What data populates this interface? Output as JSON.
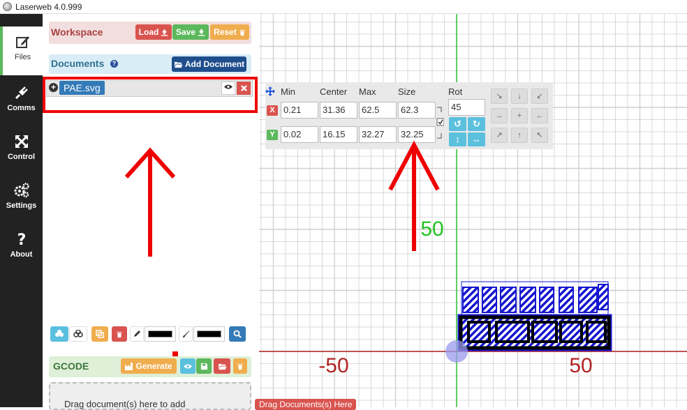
{
  "window": {
    "title": "Laserweb 4.0.999"
  },
  "sidebar": {
    "items": [
      {
        "label": "Files",
        "icon": "edit-icon",
        "active": true
      },
      {
        "label": "Comms",
        "icon": "plug-icon"
      },
      {
        "label": "Control",
        "icon": "move-icon"
      },
      {
        "label": "Settings",
        "icon": "gears-icon"
      },
      {
        "label": "About",
        "icon": "question-icon"
      }
    ]
  },
  "workspace": {
    "title": "Workspace",
    "load_label": "Load",
    "save_label": "Save",
    "reset_label": "Reset"
  },
  "documents": {
    "title": "Documents",
    "add_label": "Add Document",
    "items": [
      {
        "name": "PAE.svg"
      }
    ]
  },
  "gcode": {
    "title": "GCODE",
    "generate_label": "Generate",
    "drop_text": "Drag document(s) here to add",
    "drag_tag": "Drag Documents(s) Here"
  },
  "transform": {
    "headers": {
      "min": "Min",
      "center": "Center",
      "max": "Max",
      "size": "Size",
      "rot": "Rot"
    },
    "x": {
      "tag": "X",
      "min": "0.21",
      "center": "31.36",
      "max": "62.5",
      "size": "62.3"
    },
    "y": {
      "tag": "Y",
      "min": "0.02",
      "center": "16.15",
      "max": "32.27",
      "size": "32.25"
    },
    "rot_value": "45",
    "align_glyphs": [
      "↘",
      "↓",
      "↙",
      "→",
      "+",
      "←",
      "↗",
      "↑",
      "↖"
    ]
  },
  "canvas": {
    "axis_labels": {
      "x_neg": "-50",
      "x_pos": "50",
      "y_pos": "50"
    },
    "colors": {
      "x_axis": "#b22222",
      "y_axis": "#22c322",
      "grid": "#cfcfcf",
      "annotation": "#ee0000"
    }
  }
}
